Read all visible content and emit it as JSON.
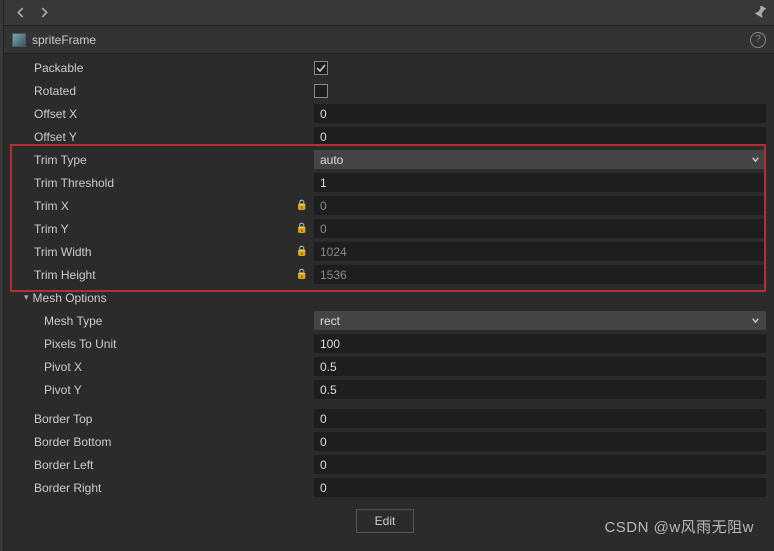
{
  "title": "spriteFrame",
  "props": {
    "packable": {
      "label": "Packable",
      "checked": true
    },
    "rotated": {
      "label": "Rotated",
      "checked": false
    },
    "offsetX": {
      "label": "Offset X",
      "value": "0"
    },
    "offsetY": {
      "label": "Offset Y",
      "value": "0"
    },
    "trimType": {
      "label": "Trim Type",
      "value": "auto"
    },
    "trimThreshold": {
      "label": "Trim Threshold",
      "value": "1"
    },
    "trimX": {
      "label": "Trim X",
      "value": "0"
    },
    "trimY": {
      "label": "Trim Y",
      "value": "0"
    },
    "trimWidth": {
      "label": "Trim Width",
      "value": "1024"
    },
    "trimHeight": {
      "label": "Trim Height",
      "value": "1536"
    },
    "meshOptions": {
      "label": "Mesh Options"
    },
    "meshType": {
      "label": "Mesh Type",
      "value": "rect"
    },
    "pixelsToUnit": {
      "label": "Pixels To Unit",
      "value": "100"
    },
    "pivotX": {
      "label": "Pivot X",
      "value": "0.5"
    },
    "pivotY": {
      "label": "Pivot Y",
      "value": "0.5"
    },
    "borderTop": {
      "label": "Border Top",
      "value": "0"
    },
    "borderBottom": {
      "label": "Border Bottom",
      "value": "0"
    },
    "borderLeft": {
      "label": "Border Left",
      "value": "0"
    },
    "borderRight": {
      "label": "Border Right",
      "value": "0"
    }
  },
  "editButton": "Edit",
  "watermark": "CSDN @w风雨无阻w"
}
